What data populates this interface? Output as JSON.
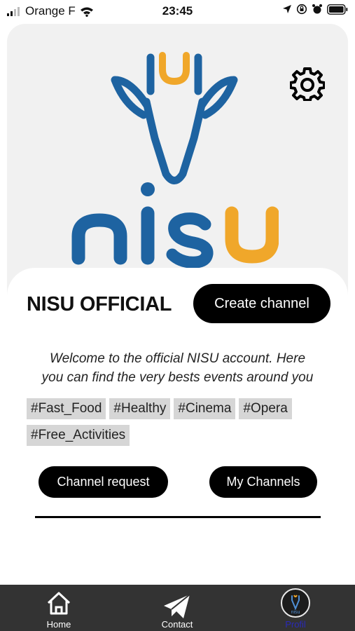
{
  "status_bar": {
    "carrier": "Orange F",
    "time": "23:45"
  },
  "brand": {
    "name": "nisu",
    "blue": "#1e63a1",
    "yellow": "#f0a72a"
  },
  "header": {
    "title": "NISU OFFICIAL",
    "create_button": "Create channel",
    "settings_icon": "gear-icon"
  },
  "description": {
    "line1": "Welcome to the official NISU account. Here",
    "line2": "you can find the very bests events around you"
  },
  "tags": [
    "#Fast_Food",
    "#Healthy",
    "#Cinema",
    "#Opera",
    "#Free_Activities"
  ],
  "actions": {
    "channel_request": "Channel request",
    "my_channels": "My Channels"
  },
  "tabbar": {
    "items": [
      {
        "label": "Home",
        "icon": "home-icon"
      },
      {
        "label": "Contact",
        "icon": "paper-plane-icon"
      },
      {
        "label": "Profil",
        "icon": "avatar",
        "active_color": "#2a2ab8"
      }
    ]
  }
}
